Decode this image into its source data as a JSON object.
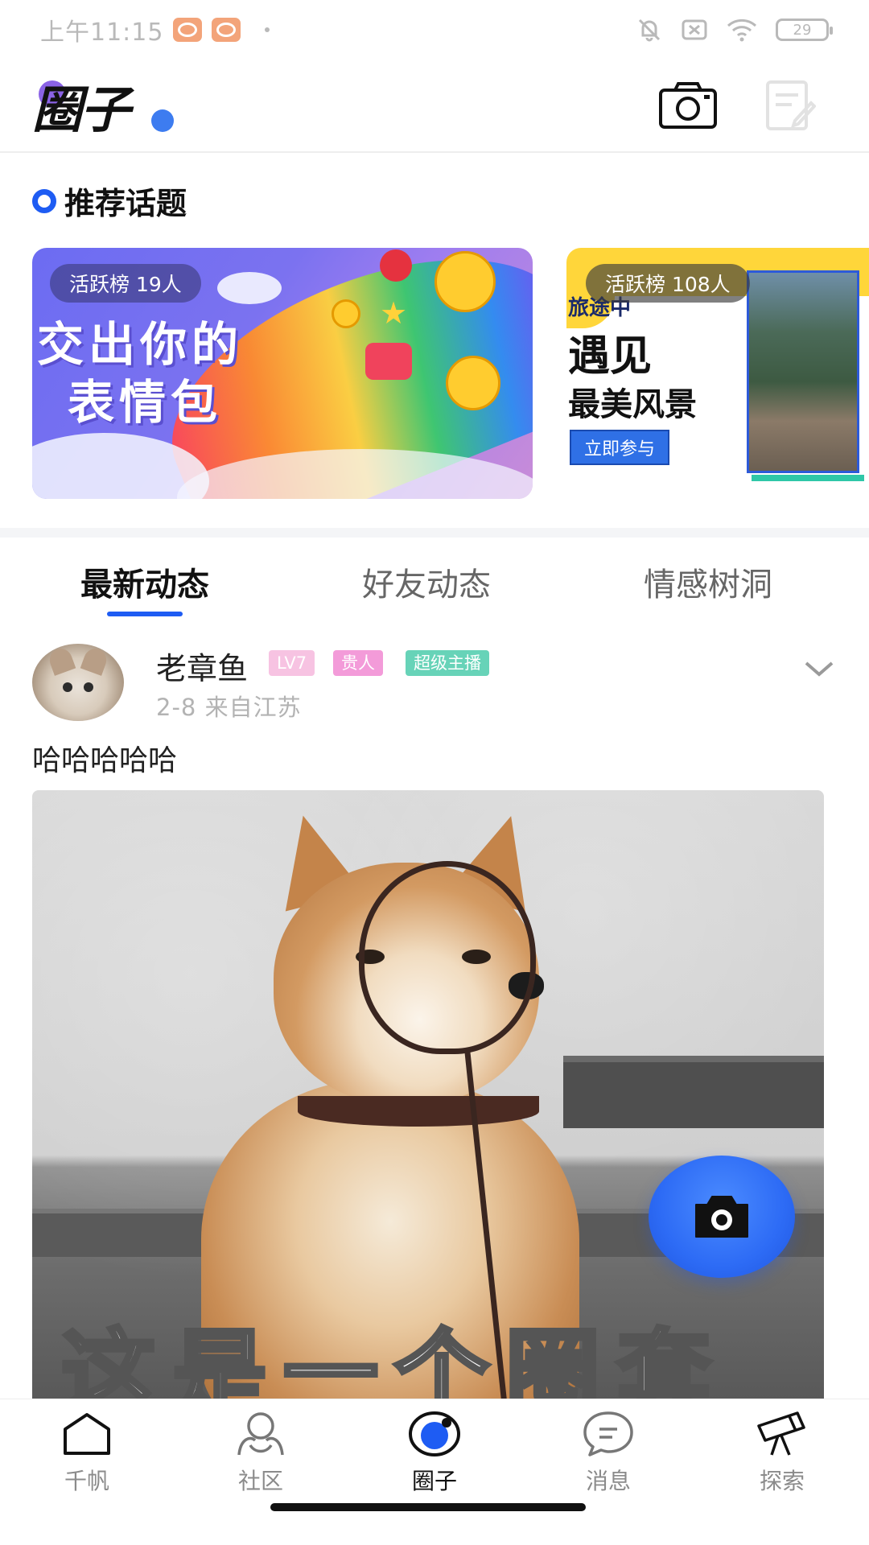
{
  "status_bar": {
    "time": "上午11:15",
    "battery": "29"
  },
  "header": {
    "logo_text": "圈子",
    "camera_icon": "camera-icon",
    "edit_icon": "edit-note-icon"
  },
  "topics": {
    "section_title": "推荐话题",
    "cards": [
      {
        "badge": "活跃榜 19人",
        "title_line1": "交出你的",
        "title_line2": "表情包"
      },
      {
        "badge": "活跃榜 108人",
        "subtitle": "旅途中",
        "title_big": "遇见",
        "title_mid": "最美风景",
        "button": "立即参与"
      }
    ]
  },
  "tabs": [
    {
      "label": "最新动态",
      "active": true
    },
    {
      "label": "好友动态",
      "active": false
    },
    {
      "label": "情感树洞",
      "active": false
    }
  ],
  "post": {
    "username": "老章鱼",
    "tags": [
      "LV7",
      "贵人",
      "超级主播"
    ],
    "meta": "2-8  来自江苏",
    "text": "哈哈哈哈哈",
    "image_caption": "这是一个圈套"
  },
  "bottom_nav": [
    {
      "label": "千帆",
      "icon": "home-icon",
      "active": false
    },
    {
      "label": "社区",
      "icon": "community-icon",
      "active": false
    },
    {
      "label": "圈子",
      "icon": "circle-icon",
      "active": true
    },
    {
      "label": "消息",
      "icon": "message-icon",
      "active": false
    },
    {
      "label": "探索",
      "icon": "telescope-icon",
      "active": false
    }
  ],
  "colors": {
    "accent": "#1e5cf3",
    "tag_lv": "#f7c3e2",
    "tag_vip": "#f39bd9",
    "tag_host": "#67d3b8"
  }
}
